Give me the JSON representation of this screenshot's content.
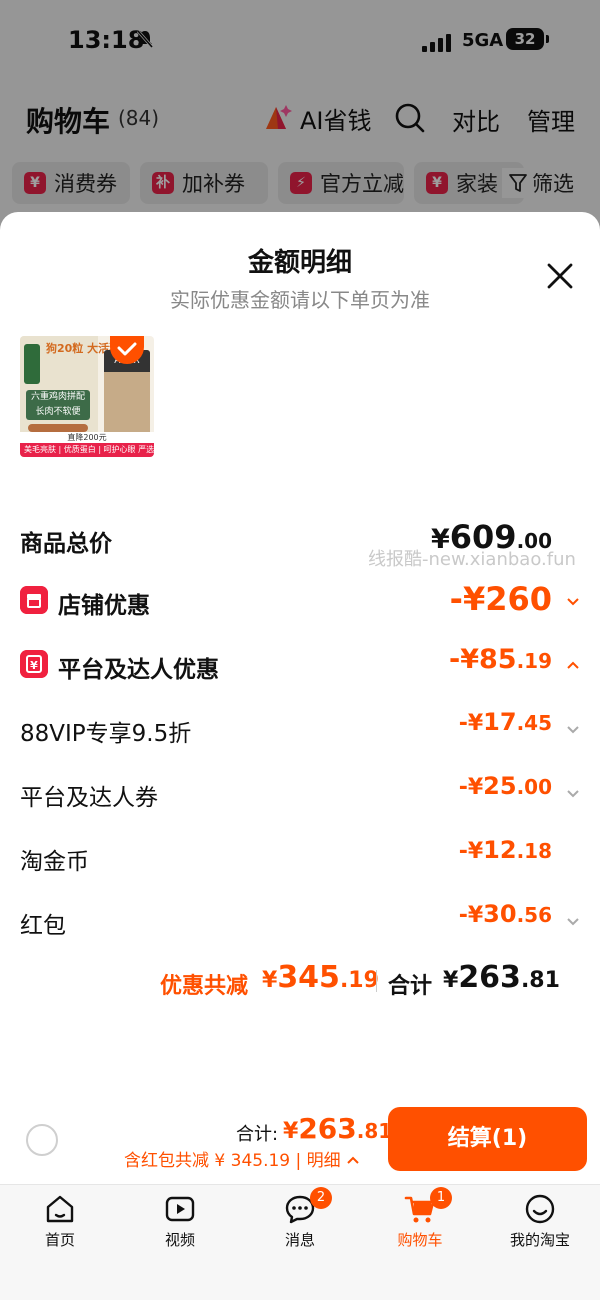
{
  "status_bar": {
    "time": "13:18",
    "network": "5GA",
    "battery": "32"
  },
  "cart_header": {
    "title": "购物车",
    "count": "(84)",
    "ai_label": "AI省钱",
    "compare_label": "对比",
    "manage_label": "管理"
  },
  "filter_chips": [
    {
      "badge": "¥",
      "label": "消费券"
    },
    {
      "badge": "补",
      "label": "加补券"
    },
    {
      "badge": "⚡",
      "label": "官方立减"
    },
    {
      "badge": "¥",
      "label": "家装"
    }
  ],
  "filter_button_label": "筛选",
  "sheet": {
    "title": "金额明细",
    "subtitle": "实际优惠金额请以下单页为准",
    "product_image": {
      "headline": "狗20粒 大活狗粮",
      "badge_text": "六重鸡肉拼配 长肉不软便",
      "bag_label": "AGAR",
      "price_line": "直降200元",
      "strip_text": "美毛亮肤 | 优质蛋白 | 呵护心眼  严选"
    },
    "rows": [
      {
        "label": "商品总价",
        "yen": "¥",
        "int": "609",
        "dec": ".00"
      },
      {
        "label": "店铺优惠",
        "yen": "-¥",
        "int": "260",
        "dec": ""
      },
      {
        "label": "平台及达人优惠",
        "yen": "-¥",
        "int": "85",
        "dec": ".19"
      },
      {
        "label": "88VIP专享9.5折",
        "yen": "-¥",
        "int": "17",
        "dec": ".45"
      },
      {
        "label": "平台及达人券",
        "yen": "-¥",
        "int": "25",
        "dec": ".00"
      },
      {
        "label": "淘金币",
        "yen": "-¥",
        "int": "12",
        "dec": ".18"
      },
      {
        "label": "红包",
        "yen": "-¥",
        "int": "30",
        "dec": ".56"
      }
    ],
    "summary": {
      "discount_label": "优惠共减",
      "discount_yen": "¥",
      "discount_int": "345",
      "discount_dec": ".19",
      "total_label": "合计",
      "total_yen": "¥",
      "total_int": "263",
      "total_dec": ".81"
    }
  },
  "watermark": "线报酷-new.xianbao.fun",
  "checkout": {
    "sum_label": "合计:",
    "sum_yen": "¥",
    "sum_int": "263",
    "sum_dec": ".81",
    "subline": "含红包共减 ¥ 345.19 | 明细",
    "pay_label": "结算(1)"
  },
  "tabbar": [
    {
      "label": "首页",
      "icon": "home-icon"
    },
    {
      "label": "视频",
      "icon": "video-icon"
    },
    {
      "label": "消息",
      "icon": "message-icon",
      "badge": "2"
    },
    {
      "label": "购物车",
      "icon": "cart-icon",
      "badge": "1",
      "active": true
    },
    {
      "label": "我的淘宝",
      "icon": "profile-icon"
    }
  ],
  "colors": {
    "accent": "#ff5000",
    "badge_red": "#e8224a",
    "text_dark": "#111111",
    "text_muted": "#888888"
  }
}
